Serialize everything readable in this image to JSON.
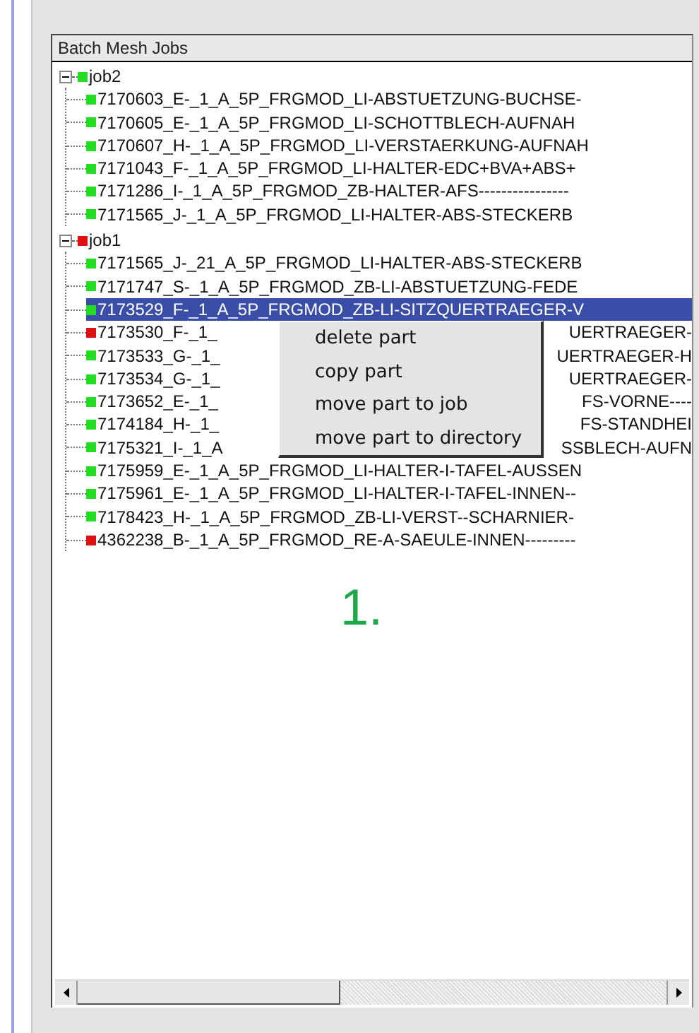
{
  "panel": {
    "title": "Batch Mesh Jobs"
  },
  "jobs": [
    {
      "name": "job2",
      "color": "#22dd22",
      "expanded": true,
      "parts": [
        {
          "text": "7170603_E-_1_A_5P_FRGMOD_LI-ABSTUETZUNG-BUCHSE-",
          "color": "#22dd22",
          "selected": false
        },
        {
          "text": "7170605_E-_1_A_5P_FRGMOD_LI-SCHOTTBLECH-AUFNAH",
          "color": "#22dd22",
          "selected": false
        },
        {
          "text": "7170607_H-_1_A_5P_FRGMOD_LI-VERSTAERKUNG-AUFNAH",
          "color": "#22dd22",
          "selected": false
        },
        {
          "text": "7171043_F-_1_A_5P_FRGMOD_LI-HALTER-EDC+BVA+ABS+",
          "color": "#22dd22",
          "selected": false
        },
        {
          "text": "7171286_I-_1_A_5P_FRGMOD_ZB-HALTER-AFS----------------",
          "color": "#22dd22",
          "selected": false
        },
        {
          "text": "7171565_J-_1_A_5P_FRGMOD_LI-HALTER-ABS-STECKERB",
          "color": "#22dd22",
          "selected": false
        }
      ]
    },
    {
      "name": "job1",
      "color": "#dd1111",
      "expanded": true,
      "parts": [
        {
          "text": "7171565_J-_21_A_5P_FRGMOD_LI-HALTER-ABS-STECKERB",
          "color": "#22dd22",
          "selected": false
        },
        {
          "text": "7171747_S-_1_A_5P_FRGMOD_ZB-LI-ABSTUETZUNG-FEDE",
          "color": "#22dd22",
          "selected": false
        },
        {
          "text": "7173529_F-_1_A_5P_FRGMOD_ZB-LI-SITZQUERTRAEGER-V",
          "color": "#22dd22",
          "selected": true
        },
        {
          "text": "7173530_F-_1_",
          "text_end": "UERTRAEGER-",
          "color": "#dd1111",
          "selected": false
        },
        {
          "text": "7173533_G-_1_",
          "text_end": "UERTRAEGER-H",
          "color": "#22dd22",
          "selected": false
        },
        {
          "text": "7173534_G-_1_",
          "text_end": "UERTRAEGER-",
          "color": "#22dd22",
          "selected": false
        },
        {
          "text": "7173652_E-_1_",
          "text_end": "FS-VORNE----",
          "color": "#22dd22",
          "selected": false
        },
        {
          "text": "7174184_H-_1_",
          "text_end": "FS-STANDHEI",
          "color": "#22dd22",
          "selected": false
        },
        {
          "text": "7175321_I-_1_A",
          "text_end": "SSBLECH-AUFN",
          "color": "#22dd22",
          "selected": false
        },
        {
          "text": "7175959_E-_1_A_5P_FRGMOD_LI-HALTER-I-TAFEL-AUSSEN",
          "color": "#22dd22",
          "selected": false
        },
        {
          "text": "7175961_E-_1_A_5P_FRGMOD_LI-HALTER-I-TAFEL-INNEN--",
          "color": "#22dd22",
          "selected": false
        },
        {
          "text": "7178423_H-_1_A_5P_FRGMOD_ZB-LI-VERST--SCHARNIER-",
          "color": "#22dd22",
          "selected": false
        },
        {
          "text": "4362238_B-_1_A_5P_FRGMOD_RE-A-SAEULE-INNEN---------",
          "color": "#dd1111",
          "selected": false
        }
      ]
    }
  ],
  "context_menu": [
    "delete part",
    "copy part",
    "move part to job",
    "move part to directory"
  ],
  "annotation": "1."
}
